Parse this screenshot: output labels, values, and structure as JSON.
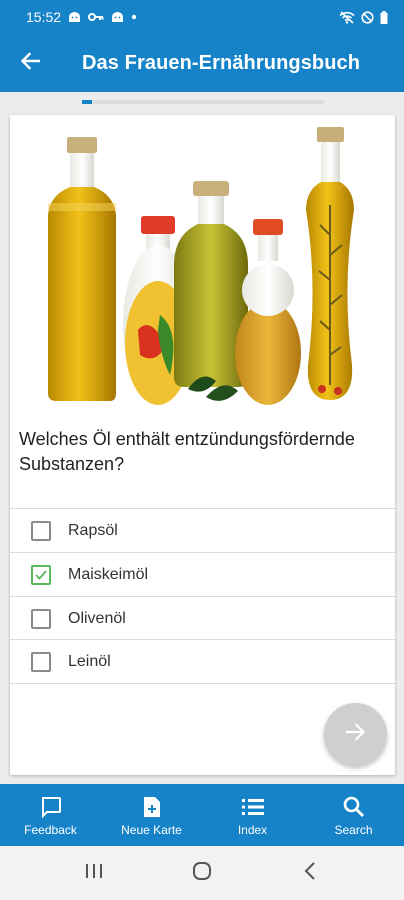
{
  "status_bar": {
    "time": "15:52",
    "left_icons": [
      "android-icon",
      "key-icon",
      "android-icon",
      "dot-icon"
    ],
    "right_icons": [
      "wifi-off-icon",
      "do-not-disturb-icon",
      "battery-icon"
    ]
  },
  "app_bar": {
    "title": "Das Frauen-Ernährungsbuch",
    "back_icon": "arrow-left-icon"
  },
  "progress": {
    "fraction": 0.04,
    "color": "#1683c9"
  },
  "card": {
    "image": "oil-bottles-illustration",
    "question": "Welches Öl enthält entzündungsfördernde Substanzen?",
    "options": [
      {
        "label": "Rapsöl",
        "checked": false
      },
      {
        "label": "Maiskeimöl",
        "checked": true
      },
      {
        "label": "Olivenöl",
        "checked": false
      },
      {
        "label": "Leinöl",
        "checked": false
      }
    ]
  },
  "fab": {
    "icon": "arrow-right-icon"
  },
  "bottom_nav": [
    {
      "label": "Feedback",
      "icon": "feedback-icon"
    },
    {
      "label": "Neue Karte",
      "icon": "new-card-icon"
    },
    {
      "label": "Index",
      "icon": "list-icon"
    },
    {
      "label": "Search",
      "icon": "search-icon"
    }
  ],
  "system_nav": [
    "recents-icon",
    "home-icon",
    "back-icon"
  ],
  "colors": {
    "primary": "#1683c9",
    "check": "#5cb85c",
    "fab": "#cfcfcf"
  }
}
